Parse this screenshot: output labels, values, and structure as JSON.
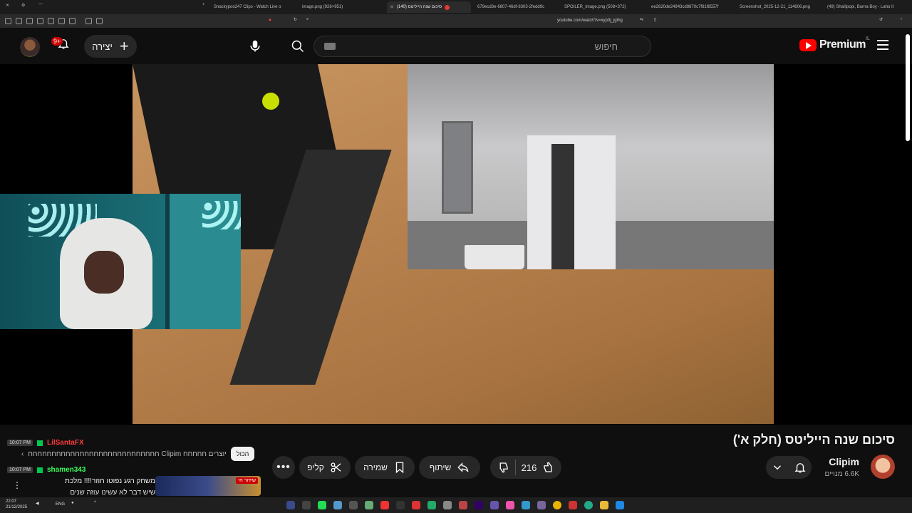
{
  "browser": {
    "tabs": [
      {
        "label": "Snackypoo247 Clips - Watch Live o",
        "active": false
      },
      {
        "label": "image.png (926×951)",
        "active": false
      },
      {
        "label": "(140) סיכום שנה הייליטס",
        "active": true
      },
      {
        "label": "679ecd3e-6807-46df-8303-2fedd9c",
        "active": false
      },
      {
        "label": "SPOILER_image.png (508×372)",
        "active": false
      },
      {
        "label": "ee2620de24943cd8870c7f81f8557f",
        "active": false
      },
      {
        "label": "Screenshot_2025-12-21_114606.png",
        "active": false
      },
      {
        "label": "(49) Shallipopi, Burna Boy - Laho II",
        "active": false
      }
    ],
    "url": "youtube.com/watch?v=xyp0j_jgthg"
  },
  "header": {
    "brand": "Premium",
    "country": "IL",
    "search_placeholder": "חיפוש",
    "create_label": "יצירה",
    "notifications_badge": "9+"
  },
  "video": {
    "title": "סיכום שנה הייליטס (חלק א')"
  },
  "channel": {
    "name": "Clipim",
    "subscribers": "6.6K מנויים"
  },
  "actions": {
    "likes": "216",
    "share": "שיתוף",
    "save": "שמירה",
    "clip": "קליפ"
  },
  "chat": {
    "messages": [
      {
        "time": "10:07 PM",
        "user": "LilSantaFX"
      },
      {
        "time": "10:07 PM",
        "user": "shamen343"
      }
    ],
    "chips_text": "חחחחחחחחחחחחחחחחחחחחחחחחחחחח Clipim יוצרים חחחחח",
    "chip_all": "הכול",
    "msg_line1": "משחק רגע נפוטו חוזר!!!! מלכת",
    "msg_line2": "שיש דבר לא עשינו עוזה שנים",
    "ad_tag": "שידור חי"
  },
  "taskbar": {
    "time": "22:07",
    "date": "21/12/2025",
    "lang": "ENG"
  },
  "colors": {
    "brand_red": "#ff0000",
    "background": "#0f0f0f",
    "pill": "#272727"
  }
}
